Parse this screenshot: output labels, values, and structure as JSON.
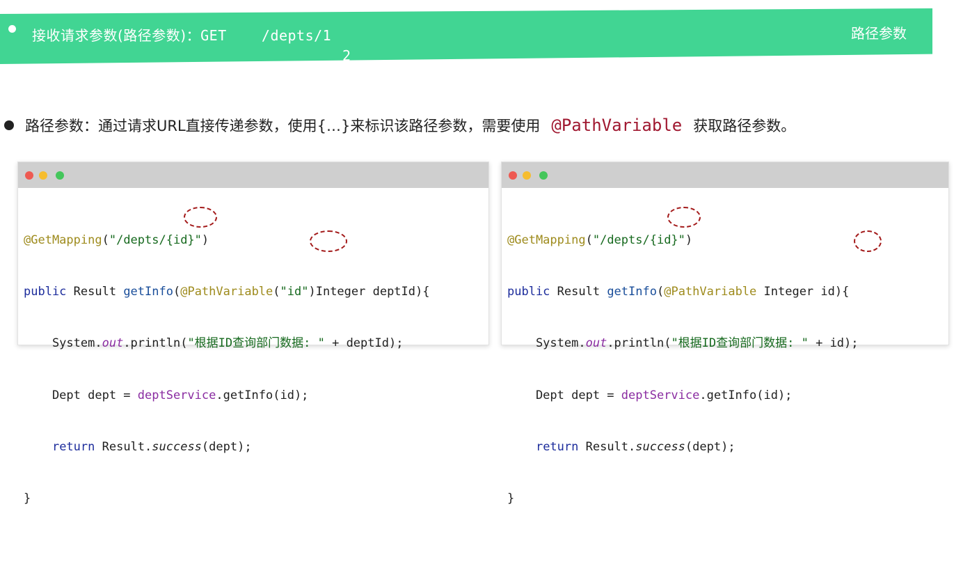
{
  "banner": {
    "title_prefix": "接收请求参数(路径参数)：",
    "title_code": "GET    /depts/1",
    "title_line2": "2",
    "right_label": "路径参数"
  },
  "description": {
    "text_before": "路径参数：通过请求URL直接传递参数，使用{…}来标识该路径参数，需要使用",
    "annotation": "@PathVariable",
    "text_after": "获取路径参数。"
  },
  "left_panel": {
    "l1_ann": "@GetMapping",
    "l1_a": "(",
    "l1_str": "\"/depts/{id}\"",
    "l1_b": ")",
    "l2_kw": "public",
    "l2_a": " Result ",
    "l2_fn": "getInfo",
    "l2_b": "(",
    "l2_ann": "@PathVariable",
    "l2_c": "(",
    "l2_str": "\"id\"",
    "l2_d": ")Integer deptId){",
    "l3_a": "    System.",
    "l3_out": "out",
    "l3_b": ".println(",
    "l3_str": "\"根据ID查询部门数据: \"",
    "l3_c": " + deptId);",
    "l4_a": "    Dept dept = ",
    "l4_fld": "deptService",
    "l4_b": ".getInfo(id);",
    "l5_ind": "    ",
    "l5_kw": "return",
    "l5_a": " Result.",
    "l5_it": "success",
    "l5_b": "(dept);",
    "l6": "}"
  },
  "right_panel": {
    "l1_ann": "@GetMapping",
    "l1_a": "(",
    "l1_str": "\"/depts/{id}\"",
    "l1_b": ")",
    "l2_kw": "public",
    "l2_a": " Result ",
    "l2_fn": "getInfo",
    "l2_b": "(",
    "l2_ann": "@PathVariable",
    "l2_c": " Integer id){",
    "l3_a": "    System.",
    "l3_out": "out",
    "l3_b": ".println(",
    "l3_str": "\"根据ID查询部门数据: \"",
    "l3_c": " + id);",
    "l4_a": "    Dept dept = ",
    "l4_fld": "deptService",
    "l4_b": ".getInfo(id);",
    "l5_ind": "    ",
    "l5_kw": "return",
    "l5_a": " Result.",
    "l5_it": "success",
    "l5_b": "(dept);",
    "l6": "}"
  },
  "colors": {
    "banner": "#41d593",
    "annotation": "#a01830",
    "highlight_circle": "#a31a1a"
  }
}
